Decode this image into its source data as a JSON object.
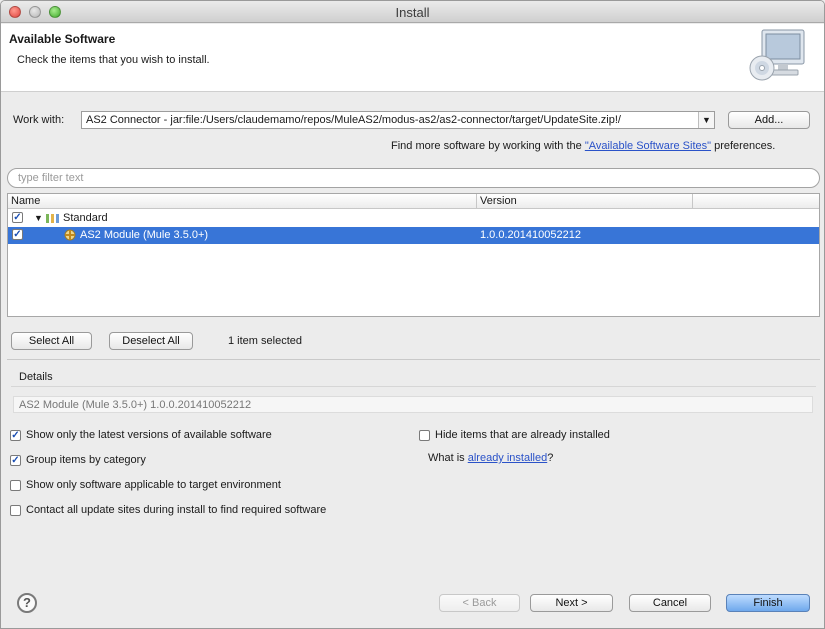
{
  "window": {
    "title": "Install"
  },
  "header": {
    "title": "Available Software",
    "subtitle": "Check the items that you wish to install.",
    "icon": "computer-install-icon"
  },
  "work_with": {
    "label": "Work with:",
    "value": "AS2 Connector - jar:file:/Users/claudemamo/repos/MuleAS2/modus-as2/as2-connector/target/UpdateSite.zip!/",
    "add_button": "Add...",
    "find_more_prefix": "Find more software by working with the ",
    "find_more_link": "\"Available Software Sites\"",
    "find_more_suffix": " preferences."
  },
  "filter": {
    "placeholder": "type filter text"
  },
  "table": {
    "columns": [
      "Name",
      "Version"
    ],
    "rows": [
      {
        "checked": true,
        "name": "Standard",
        "version": "",
        "icon": "category-icon",
        "expanded": true,
        "selected": false
      },
      {
        "checked": true,
        "name": "AS2 Module (Mule 3.5.0+)",
        "version": "1.0.0.201410052212",
        "icon": "plugin-icon",
        "selected": true
      }
    ]
  },
  "selection": {
    "select_all": "Select All",
    "deselect_all": "Deselect All",
    "status": "1 item selected"
  },
  "details": {
    "label": "Details",
    "text": "AS2 Module (Mule 3.5.0+) 1.0.0.201410052212"
  },
  "options": {
    "latest_versions": {
      "label": "Show only the latest versions of available software",
      "checked": true
    },
    "group_by_category": {
      "label": "Group items by category",
      "checked": true
    },
    "target_env": {
      "label": "Show only software applicable to target environment",
      "checked": false
    },
    "contact_sites": {
      "label": "Contact all update sites during install to find required software",
      "checked": false
    },
    "hide_installed": {
      "label": "Hide items that are already installed",
      "checked": false
    },
    "what_is_prefix": "What is ",
    "what_is_link": "already installed",
    "what_is_suffix": "?"
  },
  "buttons": {
    "back": "< Back",
    "next": "Next >",
    "cancel": "Cancel",
    "finish": "Finish"
  },
  "colors": {
    "selection": "#3875d7",
    "link": "#2a52c8",
    "default_button": "#6fa8ec"
  }
}
